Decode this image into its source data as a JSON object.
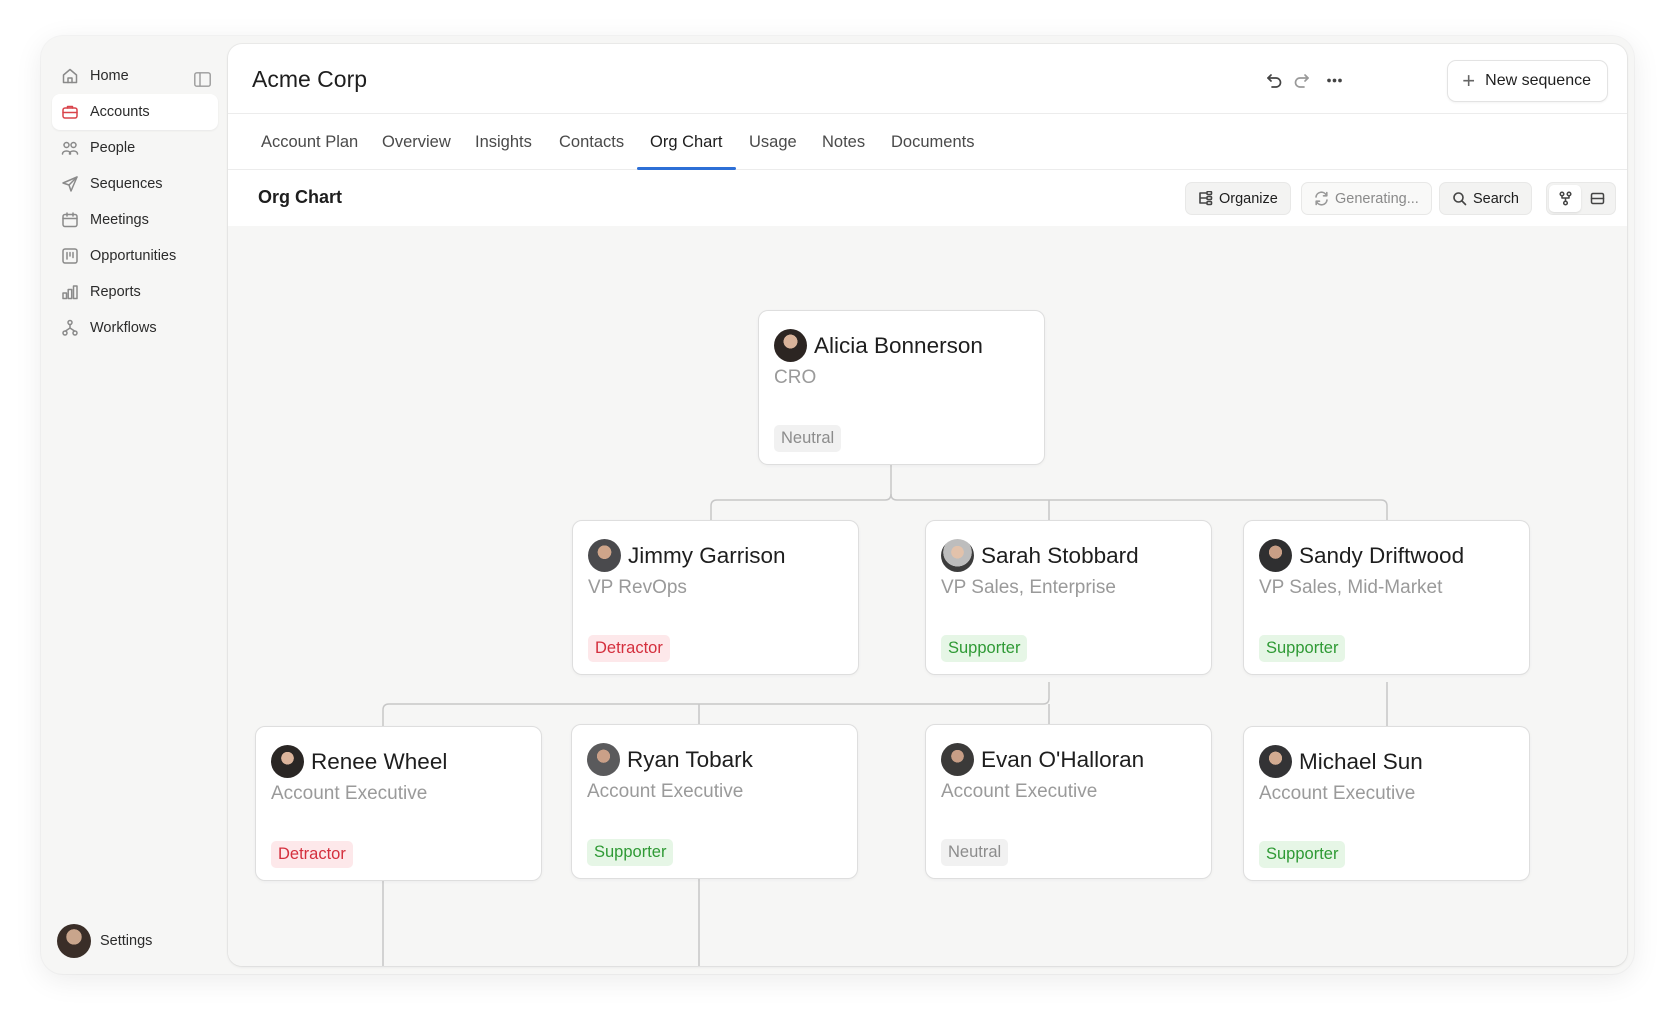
{
  "sidebar": {
    "items": [
      {
        "label": "Home",
        "icon": "home-icon"
      },
      {
        "label": "Accounts",
        "icon": "briefcase-icon",
        "active": true
      },
      {
        "label": "People",
        "icon": "people-icon"
      },
      {
        "label": "Sequences",
        "icon": "send-icon"
      },
      {
        "label": "Meetings",
        "icon": "calendar-icon"
      },
      {
        "label": "Opportunities",
        "icon": "opportunities-icon"
      },
      {
        "label": "Reports",
        "icon": "bar-chart-icon"
      },
      {
        "label": "Workflows",
        "icon": "workflow-icon"
      }
    ],
    "settings_label": "Settings"
  },
  "header": {
    "title": "Acme Corp",
    "new_sequence_label": "New sequence"
  },
  "tabs": [
    {
      "label": "Account Plan"
    },
    {
      "label": "Overview"
    },
    {
      "label": "Insights"
    },
    {
      "label": "Contacts"
    },
    {
      "label": "Org Chart",
      "active": true
    },
    {
      "label": "Usage"
    },
    {
      "label": "Notes"
    },
    {
      "label": "Documents"
    }
  ],
  "toolbar": {
    "title": "Org Chart",
    "organize_label": "Organize",
    "generating_label": "Generating...",
    "search_label": "Search"
  },
  "colors": {
    "accent": "#2d6fd6",
    "active_icon": "#d9434a",
    "detractor": "#d42f3d",
    "supporter": "#2f9a35",
    "neutral": "#8c8c8c"
  },
  "org": {
    "people": [
      {
        "name": "Alicia Bonnerson",
        "role": "CRO",
        "sentiment": "Neutral"
      },
      {
        "name": "Jimmy Garrison",
        "role": "VP RevOps",
        "sentiment": "Detractor"
      },
      {
        "name": "Sarah Stobbard",
        "role": "VP Sales, Enterprise",
        "sentiment": "Supporter"
      },
      {
        "name": "Sandy Driftwood",
        "role": "VP Sales, Mid-Market",
        "sentiment": "Supporter"
      },
      {
        "name": "Renee Wheel",
        "role": "Account Executive",
        "sentiment": "Detractor"
      },
      {
        "name": "Ryan Tobark",
        "role": "Account Executive",
        "sentiment": "Supporter"
      },
      {
        "name": "Evan O'Halloran",
        "role": "Account Executive",
        "sentiment": "Neutral"
      },
      {
        "name": "Michael Sun",
        "role": "Account Executive",
        "sentiment": "Supporter"
      }
    ]
  }
}
